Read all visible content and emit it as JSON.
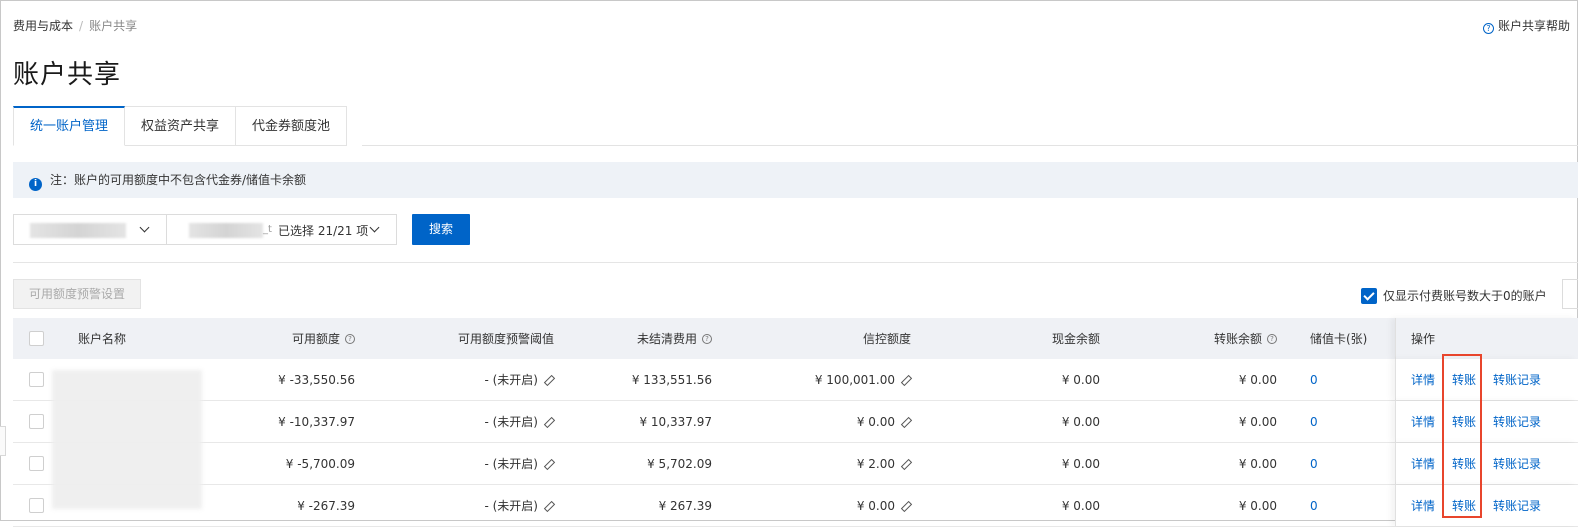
{
  "breadcrumb": {
    "parent": "费用与成本",
    "separator": "/",
    "current": "账户共享"
  },
  "help": {
    "label": "账户共享帮助",
    "icon": "question-circle-icon"
  },
  "page_title": "账户共享",
  "tabs": [
    {
      "label": "统一账户管理",
      "active": true
    },
    {
      "label": "权益资产共享",
      "active": false
    },
    {
      "label": "代金券额度池",
      "active": false
    }
  ],
  "notice": {
    "icon": "info-icon",
    "text": "注：账户的可用额度中不包含代金券/储值卡余额"
  },
  "filters": {
    "selected_count": "已选择 21/21 项",
    "search_label": "搜索",
    "tiny_suffix": "_t"
  },
  "warn_button": "可用额度预警设置",
  "only_show_checkbox": {
    "label": "仅显示付费账号数大于0的账户",
    "checked": true
  },
  "table": {
    "columns": {
      "name": "账户名称",
      "available": "可用额度",
      "threshold": "可用额度预警阈值",
      "unsettled": "未结清费用",
      "credit": "信控额度",
      "cash": "现金余额",
      "transfer_balance": "转账余额",
      "stored_card": "储值卡(张)",
      "ops": "操作"
    },
    "rows": [
      {
        "available": "¥ -33,550.56",
        "threshold": "- (未开启)",
        "unsettled": "¥ 133,551.56",
        "credit": "¥ 100,001.00",
        "cash": "¥ 0.00",
        "transfer_balance": "¥ 0.00",
        "stored_card": "0"
      },
      {
        "available": "¥ -10,337.97",
        "threshold": "- (未开启)",
        "unsettled": "¥ 10,337.97",
        "credit": "¥ 0.00",
        "cash": "¥ 0.00",
        "transfer_balance": "¥ 0.00",
        "stored_card": "0"
      },
      {
        "available": "¥ -5,700.09",
        "threshold": "- (未开启)",
        "unsettled": "¥ 5,702.09",
        "credit": "¥ 2.00",
        "cash": "¥ 0.00",
        "transfer_balance": "¥ 0.00",
        "stored_card": "0"
      },
      {
        "available": "¥ -267.39",
        "threshold": "- (未开启)",
        "unsettled": "¥ 267.39",
        "credit": "¥ 0.00",
        "cash": "¥ 0.00",
        "transfer_balance": "¥ 0.00",
        "stored_card": "0"
      }
    ],
    "actions": {
      "detail": "详情",
      "transfer": "转账",
      "transfer_record": "转账记录"
    }
  },
  "colors": {
    "primary": "#0064c8",
    "highlight": "#e8452c",
    "header_bg": "#eff1f5",
    "notice_bg": "#eef2f7"
  }
}
